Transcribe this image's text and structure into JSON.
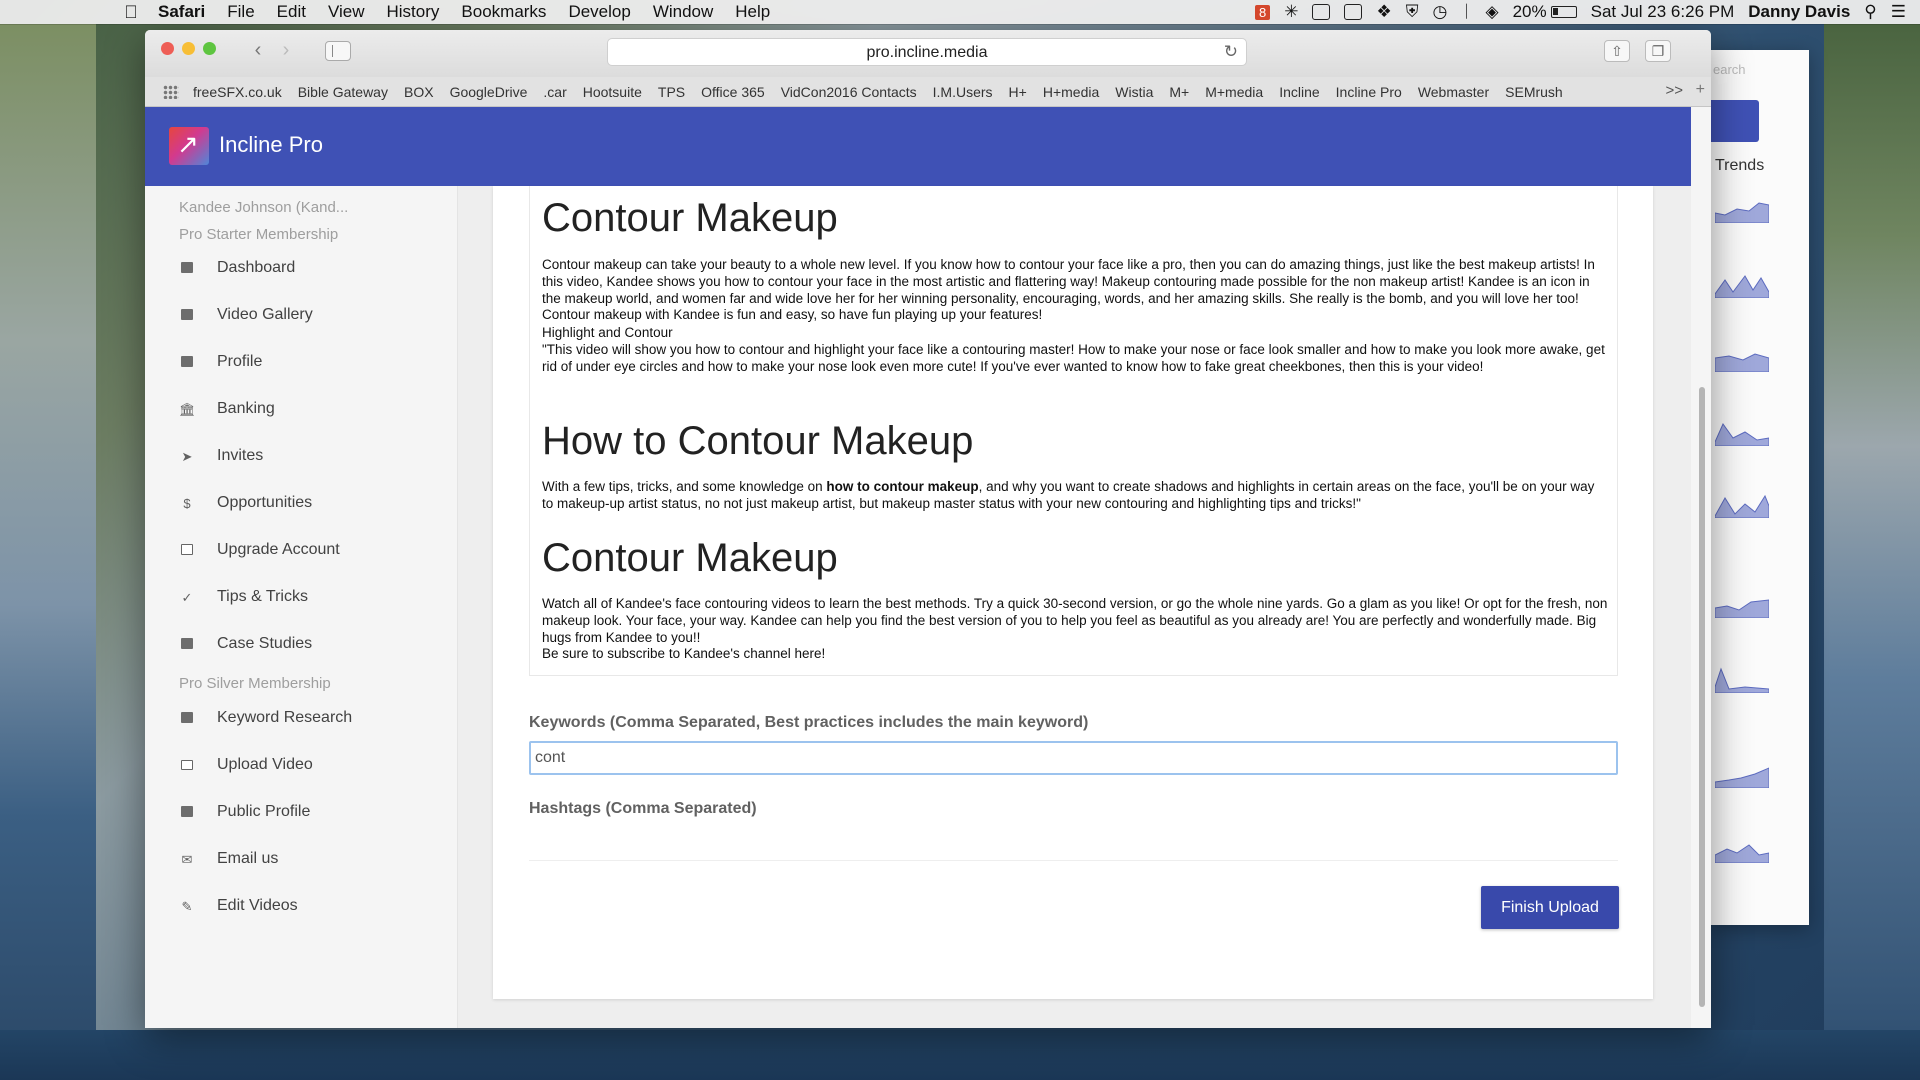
{
  "menubar": {
    "app": "Safari",
    "items": [
      "File",
      "Edit",
      "View",
      "History",
      "Bookmarks",
      "Develop",
      "Window",
      "Help"
    ],
    "badge": "8",
    "battery": "20%",
    "clock": "Sat Jul 23  6:26 PM",
    "user": "Danny Davis"
  },
  "browser": {
    "url": "pro.incline.media",
    "bookmarks": [
      "freeSFX.co.uk",
      "Bible Gateway",
      "BOX",
      "GoogleDrive",
      ".car",
      "Hootsuite",
      "TPS",
      "Office 365",
      "VidCon2016 Contacts",
      "I.M.Users",
      "H+",
      "H+media",
      "Wistia",
      "M+",
      "M+media",
      "Incline",
      "Incline Pro",
      "Webmaster",
      "SEMrush"
    ],
    "more": ">>"
  },
  "app": {
    "name": "Incline Pro",
    "brand_color": "#3f51b5",
    "button_color": "#3949ab"
  },
  "sidebar": {
    "account_name": "Kandee Johnson (Kand...",
    "starter_label": "Pro Starter Membership",
    "starter_items": [
      {
        "label": "Dashboard",
        "icon": "dashboard-icon"
      },
      {
        "label": "Video Gallery",
        "icon": "video-gallery-icon"
      },
      {
        "label": "Profile",
        "icon": "profile-icon"
      },
      {
        "label": "Banking",
        "icon": "bank-icon"
      },
      {
        "label": "Invites",
        "icon": "send-icon"
      },
      {
        "label": "Opportunities",
        "icon": "dollar-icon"
      },
      {
        "label": "Upgrade Account",
        "icon": "upgrade-icon"
      },
      {
        "label": "Tips & Tricks",
        "icon": "check-icon"
      },
      {
        "label": "Case Studies",
        "icon": "briefcase-icon"
      }
    ],
    "silver_label": "Pro Silver Membership",
    "silver_items": [
      {
        "label": "Keyword Research",
        "icon": "keyword-icon"
      },
      {
        "label": "Upload Video",
        "icon": "monitor-icon"
      },
      {
        "label": "Public Profile",
        "icon": "public-profile-icon"
      },
      {
        "label": "Email us",
        "icon": "email-icon"
      },
      {
        "label": "Edit Videos",
        "icon": "comment-icon"
      }
    ]
  },
  "description": {
    "heading1": "Contour Makeup",
    "para1": "Contour makeup can take your beauty to a whole new level. If you know how to contour your face like a pro, then you can do amazing things, just like the best makeup artists! In this video, Kandee shows you how to contour your face in the most artistic and flattering way! Makeup contouring made possible for the non makeup artist! Kandee is an icon in the makeup world, and women far and wide love her for her winning personality, encouraging, words, and her amazing skills. She really is the bomb, and you will love her too! Contour makeup with Kandee is fun and easy, so have fun playing up your features!",
    "subline": "Highlight and Contour",
    "quote": "\"This video will show you how to contour and highlight your face like a contouring master! How to make your nose or face look smaller and how to make you look more awake, get rid of under eye circles and how to make your nose look even more cute! If you've ever wanted to know how to fake great cheekbones, then this is your video!",
    "heading2": "How to Contour Makeup",
    "para2_before": "With a few tips, tricks, and some knowledge on ",
    "para2_bold": "how to contour makeup",
    "para2_after": ", and why you want to create shadows and highlights in certain areas on the face, you'll be on your way to makeup-up artist status, no not just makeup artist, but makeup master status with your new contouring and highlighting tips and tricks!\"",
    "heading3": "Contour Makeup",
    "para3": "Watch all of Kandee's face contouring videos to learn the best methods. Try a quick 30-second version, or go the whole nine yards. Go a glam as you like! Or opt for the fresh, non makeup look. Your face, your way. Kandee can help you find the best version of you to help you feel as beautiful as you already are!  You are perfectly and wonderfully made. Big hugs from Kandee to you!!",
    "para3b": "Be sure to subscribe to Kandee's channel here!"
  },
  "form": {
    "keywords_label": "Keywords (Comma Separated, Best practices includes the main keyword)",
    "keywords_value": "cont",
    "hashtags_label": "Hashtags (Comma Separated)",
    "hashtags_value": "",
    "finish_button": "Finish Upload"
  },
  "background_window": {
    "search_text": "earch",
    "trends_label": "Trends"
  }
}
